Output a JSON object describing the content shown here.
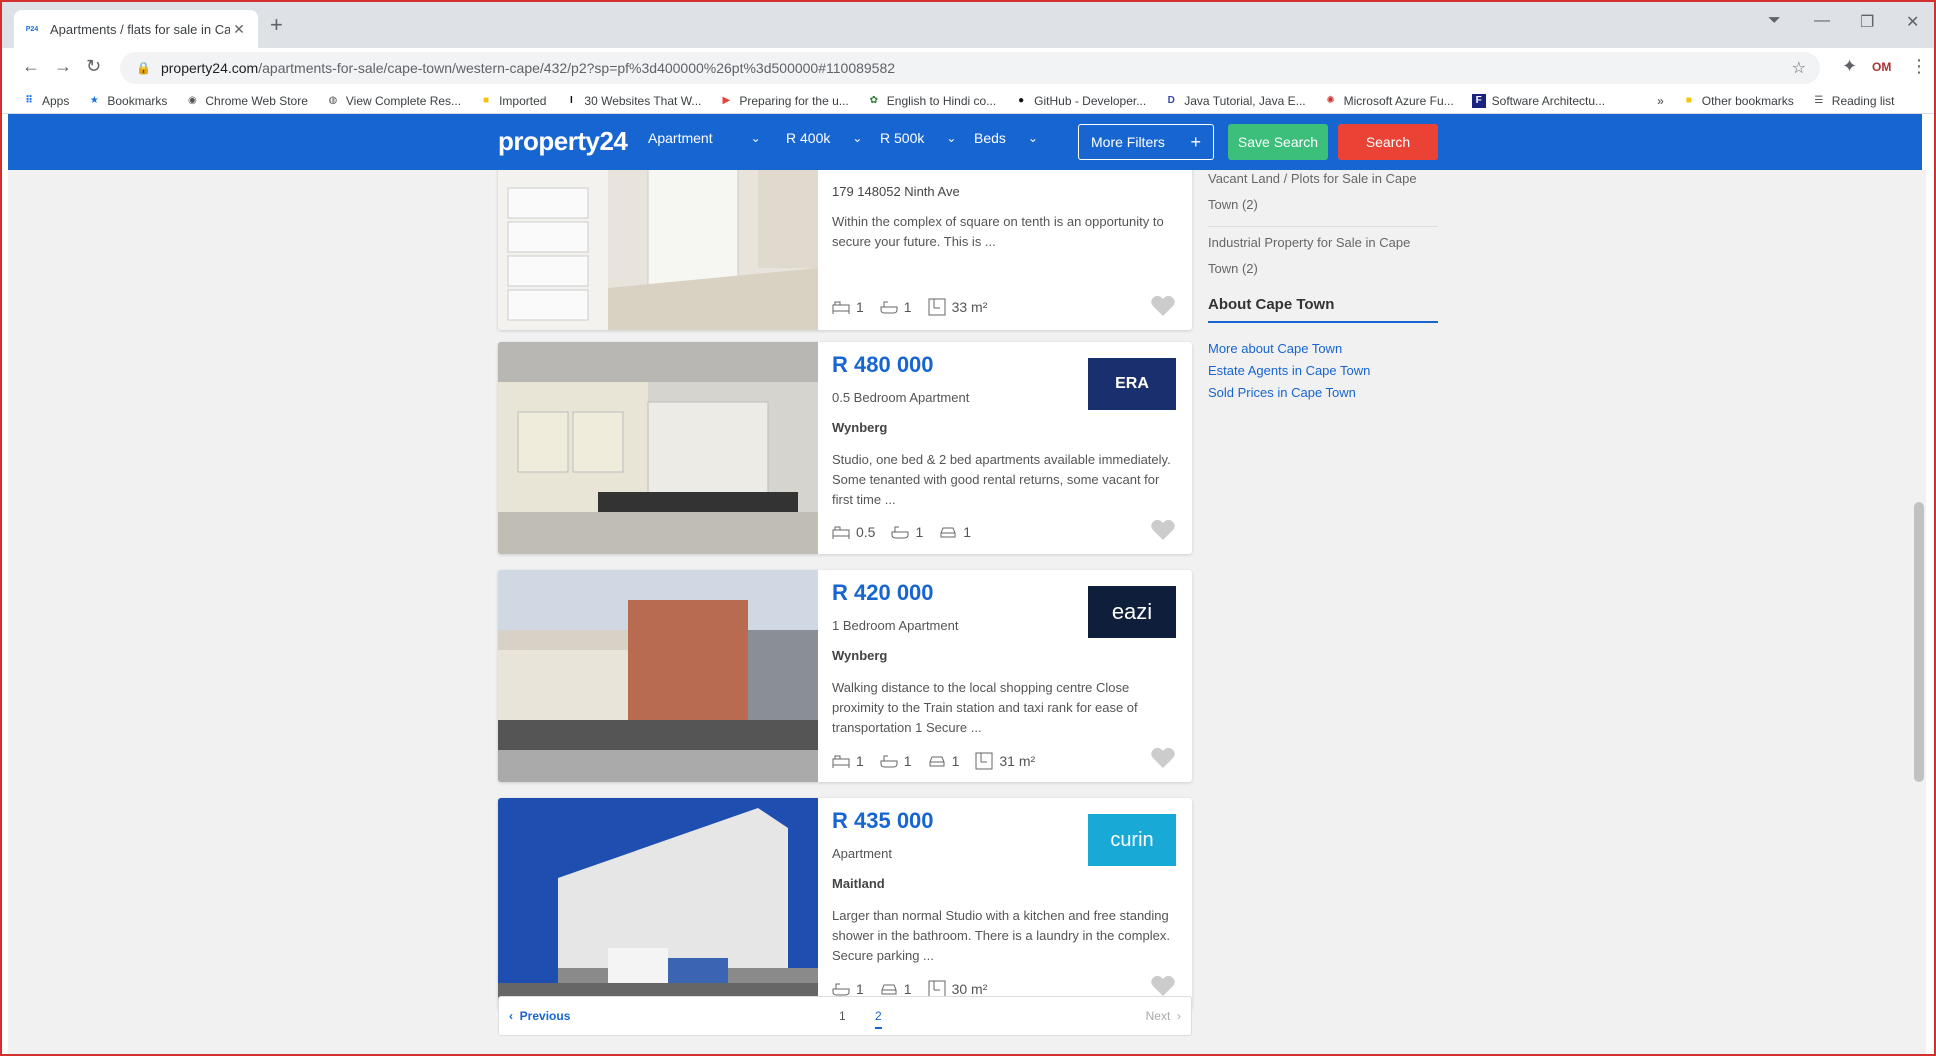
{
  "browser": {
    "tab_title": "Apartments / flats for sale in Cap",
    "url_host": "property24.com",
    "url_path": "/apartments-for-sale/cape-town/western-cape/432/p2?sp=pf%3d400000%26pt%3d500000#110089582",
    "bookmarks": [
      {
        "label": "Apps",
        "icon": "apps-grid-icon"
      },
      {
        "label": "Bookmarks",
        "icon": "star-icon"
      },
      {
        "label": "Chrome Web Store",
        "icon": "chrome-icon"
      },
      {
        "label": "View Complete Res...",
        "icon": "globe-icon"
      },
      {
        "label": "Imported",
        "icon": "folder-icon"
      },
      {
        "label": "30 Websites That W...",
        "icon": "bookmark-icon"
      },
      {
        "label": "Preparing for the u...",
        "icon": "youtube-icon"
      },
      {
        "label": "English to Hindi co...",
        "icon": "leaf-icon"
      },
      {
        "label": "GitHub - Developer...",
        "icon": "github-icon"
      },
      {
        "label": "Java Tutorial, Java E...",
        "icon": "javatpoint-icon"
      },
      {
        "label": "Microsoft Azure Fu...",
        "icon": "azure-icon"
      },
      {
        "label": "Software Architectu...",
        "icon": "f-icon"
      }
    ],
    "other_bookmarks": "Other bookmarks",
    "reading_list": "Reading list",
    "overflow": "»"
  },
  "header": {
    "logo": "property24",
    "type_select": "Apartment",
    "min_price": "R 400k",
    "max_price": "R 500k",
    "beds": "Beds",
    "more_filters": "More Filters",
    "save_search": "Save Search",
    "search": "Search",
    "accent": "#1765d1"
  },
  "listings": [
    {
      "price": "",
      "type": "",
      "suburb": "179 148052 Ninth Ave",
      "description": "Within the complex of square on tenth is an opportunity to secure your future. This is ...",
      "beds": "1",
      "baths": "1",
      "parking": "",
      "size": "33 m²",
      "agency": ""
    },
    {
      "price": "R 480 000",
      "type": "0.5 Bedroom Apartment",
      "suburb": "Wynberg",
      "description": "Studio, one bed & 2 bed apartments available immediately. Some tenanted with good rental returns, some vacant for first time ...",
      "beds": "0.5",
      "baths": "1",
      "parking": "1",
      "size": "",
      "agency": "ERA"
    },
    {
      "price": "R 420 000",
      "type": "1 Bedroom Apartment",
      "suburb": "Wynberg",
      "description": "Walking distance to the local shopping centre Close proximity to the Train station and taxi rank for ease of transportation 1 Secure ...",
      "beds": "1",
      "baths": "1",
      "parking": "1",
      "size": "31 m²",
      "agency": "eazi"
    },
    {
      "price": "R 435 000",
      "type": "Apartment",
      "suburb": "Maitland",
      "description": "Larger than normal Studio with a kitchen and free standing shower in the bathroom. There is a laundry in the complex. Secure parking ...",
      "beds": "",
      "baths": "1",
      "parking": "1",
      "size": "30 m²",
      "agency": "curin"
    }
  ],
  "sidebar": {
    "top_links": [
      "Vacant Land / Plots for Sale in Cape Town (2)",
      "Industrial Property for Sale in Cape Town (2)"
    ],
    "heading": "About Cape Town",
    "links": [
      "More about Cape Town",
      "Estate Agents in Cape Town",
      "Sold Prices in Cape Town"
    ]
  },
  "pagination": {
    "previous": "Previous",
    "pages": [
      "1",
      "2"
    ],
    "current": "2",
    "next": "Next"
  }
}
